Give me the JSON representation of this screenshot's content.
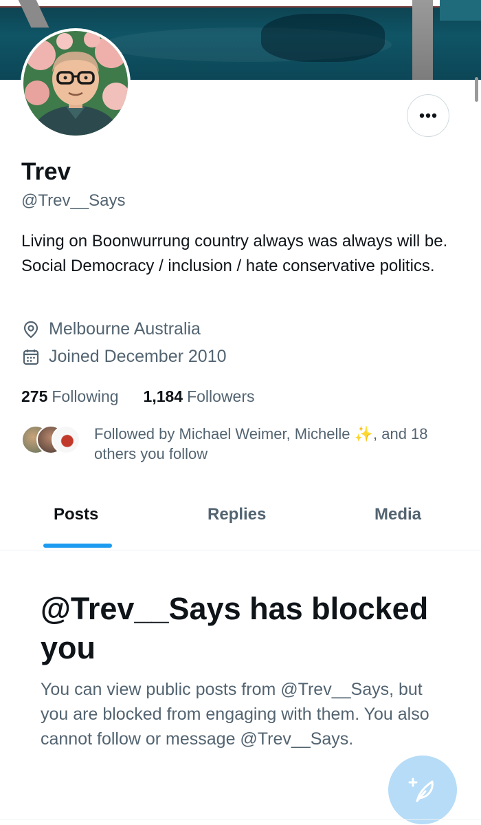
{
  "profile": {
    "name": "Trev",
    "handle": "@Trev__Says",
    "bio": "Living on Boonwurrung country always was always will be. Social Democracy / inclusion / hate conservative politics.",
    "location": "Melbourne Australia",
    "joined": "Joined December 2010"
  },
  "stats": {
    "following_count": "275",
    "following_label": "Following",
    "followers_count": "1,184",
    "followers_label": "Followers"
  },
  "followed_by": {
    "text": "Followed by Michael Weimer, Michelle ✨, and 18 others you follow"
  },
  "tabs": [
    {
      "label": "Posts",
      "active": true
    },
    {
      "label": "Replies",
      "active": false
    },
    {
      "label": "Media",
      "active": false
    }
  ],
  "blocked": {
    "title": "@Trev__Says has blocked you",
    "description": "You can view public posts from @Trev__Says, but you are blocked from engaging with them. You also cannot follow or message @Trev__Says."
  },
  "icons": {
    "more": "more-options-icon",
    "location": "location-pin-icon",
    "calendar": "calendar-icon",
    "compose": "compose-post-icon"
  },
  "colors": {
    "accent": "#1d9bf0",
    "muted_text": "#536471",
    "primary_text": "#0f1419",
    "compose_button": "#b6dcf7"
  }
}
